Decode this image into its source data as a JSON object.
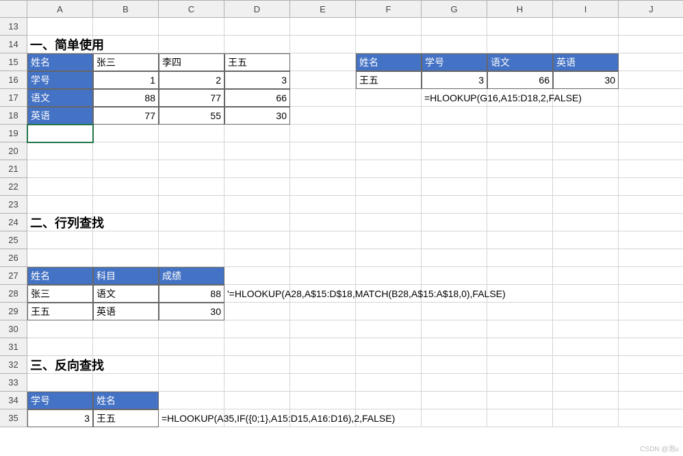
{
  "columns": [
    "A",
    "B",
    "C",
    "D",
    "E",
    "F",
    "G",
    "H",
    "I",
    "J"
  ],
  "row_start": 13,
  "row_end": 35,
  "tall_rows": [
    14,
    24,
    27,
    32,
    34
  ],
  "section1": {
    "title": "一、简单使用",
    "row_labels": [
      "姓名",
      "学号",
      "语文",
      "英语"
    ],
    "data": [
      [
        "张三",
        "李四",
        "王五"
      ],
      [
        1,
        2,
        3
      ],
      [
        88,
        77,
        66
      ],
      [
        77,
        55,
        30
      ]
    ],
    "lookup_headers": [
      "姓名",
      "学号",
      "语文",
      "英语"
    ],
    "lookup_row": [
      "王五",
      3,
      66,
      30
    ],
    "formula": "=HLOOKUP(G16,A15:D18,2,FALSE)"
  },
  "section2": {
    "title": "二、行列查找",
    "headers": [
      "姓名",
      "科目",
      "成绩"
    ],
    "rows": [
      [
        "张三",
        "语文",
        88
      ],
      [
        "王五",
        "英语",
        30
      ]
    ],
    "formula": "'=HLOOKUP(A28,A$15:D$18,MATCH(B28,A$15:A$18,0),FALSE)"
  },
  "section3": {
    "title": "三、反向查找",
    "headers": [
      "学号",
      "姓名"
    ],
    "row": [
      3,
      "王五"
    ],
    "formula": "=HLOOKUP(A35,IF({0;1},A15:D15,A16:D16),2,FALSE)"
  },
  "watermark": "CSDN @泡u"
}
